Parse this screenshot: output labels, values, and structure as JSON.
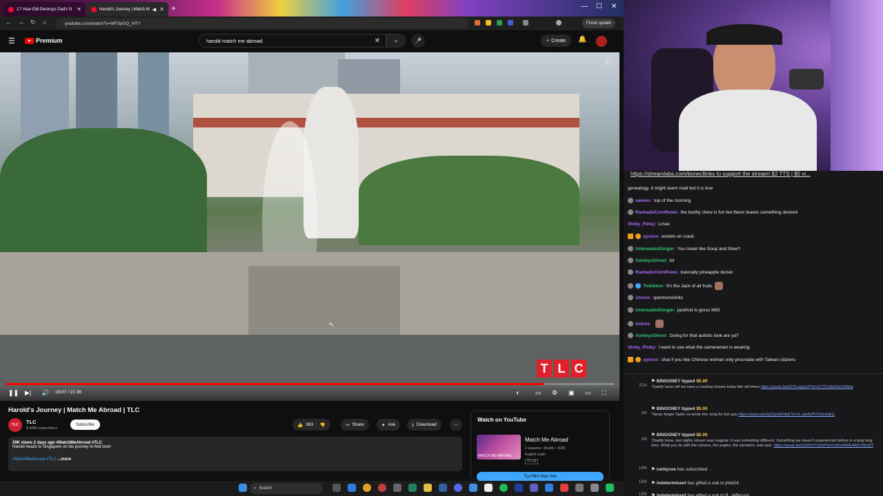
{
  "browser": {
    "tabs": [
      {
        "label": "17-Year-Old Destroys Dad's N"
      },
      {
        "label": "Harold's Journey | Match M"
      }
    ],
    "url": "youtube.com/watch?v=9iFSyGQ_HTY",
    "finish_update": "Finish update"
  },
  "youtube": {
    "logo_text": "Premium",
    "search_value": "harold match me abroad",
    "create_label": "Create",
    "player": {
      "time": "19:07 / 21:36",
      "progress": 0.885,
      "channel_bug": [
        "T",
        "L",
        "C"
      ]
    },
    "video_title": "Harold's Journey | Match Me Abroad | TLC",
    "channel": {
      "avatar_text": "TLC",
      "name": "TLC",
      "subscribers": "8.42M subscribers",
      "subscribe_label": "Subscribe"
    },
    "actions": {
      "likes": "363",
      "share": "Share",
      "ask": "Ask",
      "download": "Download"
    },
    "description": {
      "meta": "29K views  2 days ago  #MatchMeAbroad #TLC",
      "text": "Harold heads to Singapore on his journey to find love!",
      "tags": "#MatchMeAbroad #TLC",
      "more": "...more"
    },
    "watch_panel": {
      "title": "Watch on YouTube",
      "thumb_text": "MATCH ME ABROAD",
      "show": "Match Me Abroad",
      "meta": "2 seasons • Reality • 2025",
      "audio": "English audio",
      "rating": "TV-14",
      "button": "Try HBO Max free"
    }
  },
  "chat": {
    "link_line": "https://streamlabs.com/bonecllinks to support the stream! $2 TTS | $5 vi...",
    "messages": [
      {
        "user": "",
        "text": "genealogy. it might seem mad but it is true",
        "color": "#efeff1"
      },
      {
        "user": "vanwic:",
        "text": "top of the morning",
        "color": "#b070ff"
      },
      {
        "user": "RashadsCornRows:",
        "text": "the toothy chew is fun but flavor leaves something desired",
        "color": "#b070ff"
      },
      {
        "user": "Stnky_Pinky:",
        "text": "Lmao",
        "color": "#b070ff"
      },
      {
        "user": "syroco:",
        "text": "soviets on crack",
        "color": "#b070ff"
      },
      {
        "user": "UnbreadedGinger:",
        "text": "You mean like Soup and Stew?",
        "color": "#2ecc71"
      },
      {
        "user": "AshleysGhost:",
        "text": "lol",
        "color": "#2ecc71"
      },
      {
        "user": "RashadsCornRows:",
        "text": "basically pineapple durian",
        "color": "#b070ff"
      },
      {
        "user": "Tickleton:",
        "text": "It's the Jack of all fruits",
        "color": "#2ecc71"
      },
      {
        "user": "1nixxx:",
        "text": "spectrumclinks",
        "color": "#b070ff"
      },
      {
        "user": "UnbreadedGinger:",
        "text": "jackfruit is gross IMO",
        "color": "#2ecc71"
      },
      {
        "user": "1nixxx:",
        "text": "",
        "color": "#b070ff"
      },
      {
        "user": "AshleysGhost:",
        "text": "Going for that autistic look are ya?",
        "color": "#2ecc71"
      },
      {
        "user": "Stnky_Pinky:",
        "text": "I want to see what the cameraman is wearing",
        "color": "#b070ff"
      },
      {
        "user": "syroco:",
        "text": "chat if you like Chinese woman only procreate with Taiwan citizens",
        "color": "#b070ff"
      }
    ],
    "events": [
      {
        "time": "37m",
        "user": "BINGONEY tipped",
        "amount": "$5.00",
        "body": "\"Daddy bone will we have a cooking stream today like old times",
        "link": "https://youtu.be/22YLurgcb2I?si=ZTT5V3n0XeVrWkrg"
      },
      {
        "time": "1hr",
        "user": "BINGONEY tipped",
        "amount": "$5.00",
        "body": "\"Never forget Taylor co wrote this song for this guy",
        "link": "https://youtu.be/Gj21jwSEhEE?si=S_dzr8zPYOXesHEQ"
      },
      {
        "time": "1hr",
        "user": "BINGONEY tipped",
        "amount": "$5.00",
        "body": "\"Daddy bone, last nights stream was magical. It was something different. Something we haven't experienced before in a long long time. What you do with the camera, the angles, the narration, was epic.",
        "link": "https://youtu.be/OrD6VITI3XM?si=L9KmRWEA4DVSK93T"
      },
      {
        "time": "13hr",
        "user": "carbycee",
        "text": "has subscribed"
      },
      {
        "time": "13hr",
        "user": "indeterminant",
        "text": "has gifted a sub to jrtek24."
      },
      {
        "time": "13hr",
        "user": "indeterminant",
        "text": "has gifted a sub to B_Jefferson."
      }
    ]
  },
  "taskbar": {
    "search": "Search"
  }
}
